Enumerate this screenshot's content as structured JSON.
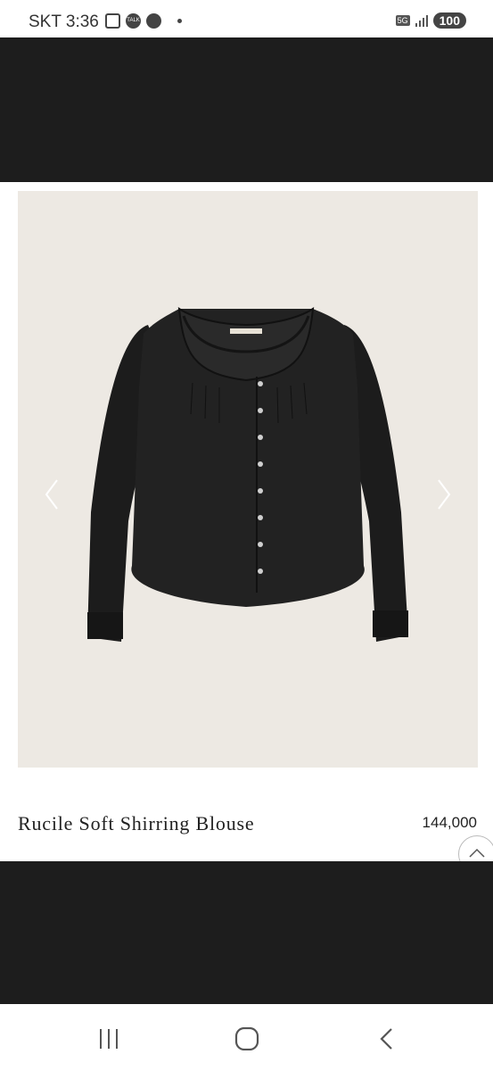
{
  "status_bar": {
    "carrier_time": "SKT 3:36",
    "talk_badge": "TALK",
    "network": "5G",
    "battery": "100"
  },
  "product": {
    "name": "Rucile Soft Shirring Blouse",
    "price": "144,000",
    "image_alt": "Black long-sleeve shirring blouse with buttons"
  },
  "icons": {
    "prev": "chevron-left-icon",
    "next": "chevron-right-icon",
    "scroll_top": "chevron-up-icon",
    "recent": "recent-apps-icon",
    "home": "home-icon",
    "back": "back-icon"
  }
}
